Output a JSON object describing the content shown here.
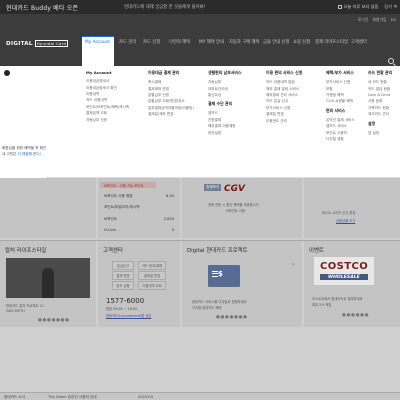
{
  "topbar": {
    "brand": "현대카드 Buddy 베타 오픈",
    "notice": "현대카드에 대해 궁금할 한 것들에게 물어봐!",
    "dont_show": "오늘 하루 보지 않음",
    "close": "닫기"
  },
  "header": {
    "util": [
      "로그인",
      "회원가입",
      "EN"
    ],
    "logo": "DIGITAL",
    "logo_sub": "Hyundai Card",
    "nav": [
      "My Account",
      "카드 관리",
      "카드 신청",
      "나만의 혜택",
      "MY 혜택 안내",
      "자동차 구매 혜택",
      "금융 안내 신청",
      "쇼핑 신청",
      "결제 라이프스타일",
      "고객센터"
    ]
  },
  "side_peek": {
    "line1": "회원님을 위한 혜택을 꼭 확인하세요",
    "line2a": "내 고민은 ",
    "line2b": "이 해결해 준다!"
  },
  "mega": {
    "columns": [
      {
        "heading": "My Account",
        "items": [
          "이용대금명세서",
          "이용대금명세서 확인",
          "이용내역",
          "카드 이용내역",
          "포인트/M포인트/혜택/캐시백",
          "결제금액 조회",
          "자동납부 신청"
        ]
      },
      {
        "heading": "이용대금 결제 관리",
        "items": [
          "즉시결제",
          "결제계좌 변경",
          "분할납부 신청",
          "분할납부 조회/변경/취소",
          "일부결제금액이월약정(리볼빙)",
          "결제일/계좌 변경"
        ]
      },
      {
        "heading": "생활편의 납부서비스",
        "items": [
          "자동납부",
          "아파트관리비",
          "통신요금"
        ],
        "heading2": "결제 수단 관리",
        "items2": [
          "앱카드",
          "간편결제",
          "해외결제 이용제한",
          "보안설정"
        ]
      },
      {
        "heading": "이용 편의 서비스 신청",
        "items": [
          "카드 이용내역 알림",
          "해외 결제 알림 서비스",
          "해외결제 관리 서비스",
          "카드 분실 신고",
          "부가서비스 신청",
          "결제일 변경",
          "이용한도 관리"
        ],
        "heading2": "개인정보 관리",
        "items2": [
          "회원정보 관리",
          "개인정보 이용동의",
          "마케팅 수신동의",
          "주소 변경",
          "비밀번호 변경",
          "로그인 설정"
        ]
      },
      {
        "heading": "혜택/부가 서비스",
        "items": [
          "부가서비스 신청",
          "보험",
          "가맹점 혜택",
          "CLIX 쇼핑몰 혜택"
        ],
        "heading2": "편의 서비스",
        "items2": [
          "온라인 결제 서비스",
          "앱카드 서비스",
          "포인트 사용처",
          "디지털 생활"
        ]
      },
      {
        "heading": "카드 현황 관리",
        "items": [
          "내 카드 현황",
          "카드 발급 현황",
          "Lock & Limit",
          "사용 등록",
          "가족카드 현황",
          "체크카드 관리"
        ],
        "heading2": "설정",
        "items2": [
          "앱 설정"
        ]
      }
    ]
  },
  "cards": {
    "points": {
      "banner": "M포인트 - 사용 가능 포인트",
      "row0_label": "M포인트 사용 예정",
      "row0_value": "8.30",
      "row1_label": "포인트/마일리지/캐시백",
      "row2_label": "M포인트",
      "row2_value": "2,834",
      "row3_label": "H-Coin",
      "row3_value": "0"
    },
    "cgv": {
      "logo": "CGV",
      "badge": "전체보기",
      "caption1": "영화 관람 시 할인 혜택을 제공합니다",
      "caption2": "M포인트 사용"
    },
    "finance": {
      "line1": "퍼스트 시리즈 신규 론칭",
      "link": "금융상품 보기"
    },
    "concert": {
      "title": "컬처 라이프스타일",
      "caption1": "현대카드 컬처 프로젝트 23",
      "caption2": "SAM SMITH"
    },
    "cs": {
      "title": "고객센터",
      "pills": [
        "분실신고",
        "카드 정지/해제",
        "결제 변경",
        "결제일 변경",
        "한도 상향",
        "이용내역 조회"
      ],
      "phone": "1577-6000",
      "hours": "평일 09:00 ~ 18:00",
      "link": "현대카드(hyundaicard)앱 상담"
    },
    "digital": {
      "title": "Digital 현대카드 프로젝트",
      "caption1": "현대카드 서비스를 디지털로 경험하세요",
      "caption2": "디지털 현대카드 혜택"
    },
    "event": {
      "title": "이벤트",
      "costco": "COSTCO",
      "wholesale": "WHOLESALE",
      "caption1": "코스트코에서 현대카드로 결제하세요",
      "caption2": "최대 5% 적립"
    }
  },
  "noticebar": {
    "label": "현대카드 소식",
    "text": "The Green 온라인 사용처 안내",
    "date": "2023.03"
  }
}
